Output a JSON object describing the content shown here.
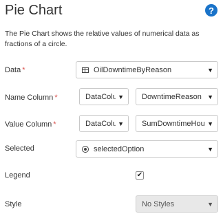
{
  "header": {
    "title": "Pie Chart",
    "help_glyph": "?"
  },
  "description": "The Pie Chart shows the relative values of numerical data as fractions of a circle.",
  "fields": {
    "data": {
      "label": "Data",
      "required_mark": "*",
      "value": "OilDowntimeByReason",
      "icon": "table-icon"
    },
    "name_column": {
      "label": "Name Column",
      "required_mark": "*",
      "source": "DataColu",
      "value": "DowntimeReason"
    },
    "value_column": {
      "label": "Value Column",
      "required_mark": "*",
      "source": "DataColu",
      "value": "SumDowntimeHours"
    },
    "selected": {
      "label": "Selected",
      "value": "selectedOption",
      "icon": "radio-icon"
    },
    "legend": {
      "label": "Legend",
      "checked": true,
      "check_glyph": "✔"
    },
    "style": {
      "label": "Style",
      "value": "No Styles",
      "disabled": true
    }
  },
  "caret_glyph": "▼",
  "colors": {
    "help": "#1a73c9",
    "required": "#d9534f",
    "disabled_bg": "#e8e8e8"
  }
}
